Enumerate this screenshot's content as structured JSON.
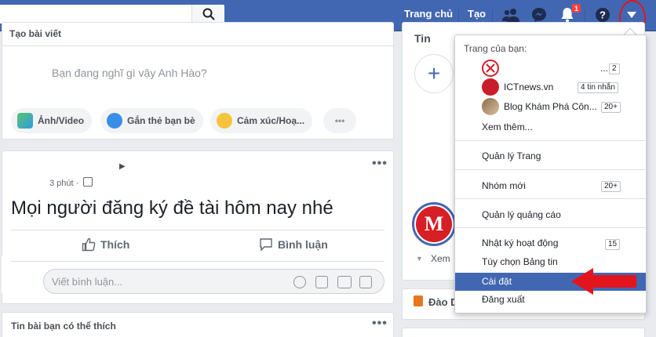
{
  "topbar": {
    "nav": [
      "Trang chủ",
      "Tạo"
    ],
    "notification_count": "1"
  },
  "composer": {
    "title": "Tạo bài viết",
    "placeholder": "Bạn đang nghĩ gì vậy Anh Hào?",
    "actions": [
      "Ảnh/Video",
      "Gắn thẻ bạn bè",
      "Cảm xúc/Hoạ...",
      "•••"
    ]
  },
  "post": {
    "time": "3 phút · ",
    "menu": "•••",
    "text": "Mọi người đăng ký đề tài hôm nay nhé",
    "like_label": "Thích",
    "comment_label": "Bình luận",
    "comment_placeholder": "Viết bình luận..."
  },
  "suggested": {
    "title": "Tin bài bạn có thể thích",
    "menu": "•••"
  },
  "right_col": {
    "stories_title": "Tin",
    "see_more": "Xem",
    "birthday_label": "Đào D"
  },
  "dropdown": {
    "section_title": "Trang của bạn:",
    "pages": [
      {
        "name": "...",
        "badge": "2"
      },
      {
        "name": "ICTnews.vn",
        "badge": "4 tin nhắn"
      },
      {
        "name": "Blog Khám Phá Côn...",
        "badge": "20+"
      }
    ],
    "see_more": "Xem thêm...",
    "manage_page": "Quản lý Trang",
    "new_groups": "Nhóm mới",
    "new_groups_badge": "20+",
    "manage_ads": "Quản lý quảng cáo",
    "activity_log": "Nhật ký hoạt động",
    "activity_badge": "15",
    "feed_prefs": "Tùy chọn Bảng tin",
    "settings": "Cài đặt",
    "logout": "Đăng xuất"
  },
  "colors": {
    "brand": "#4267b2",
    "highlight": "#e4141c"
  }
}
